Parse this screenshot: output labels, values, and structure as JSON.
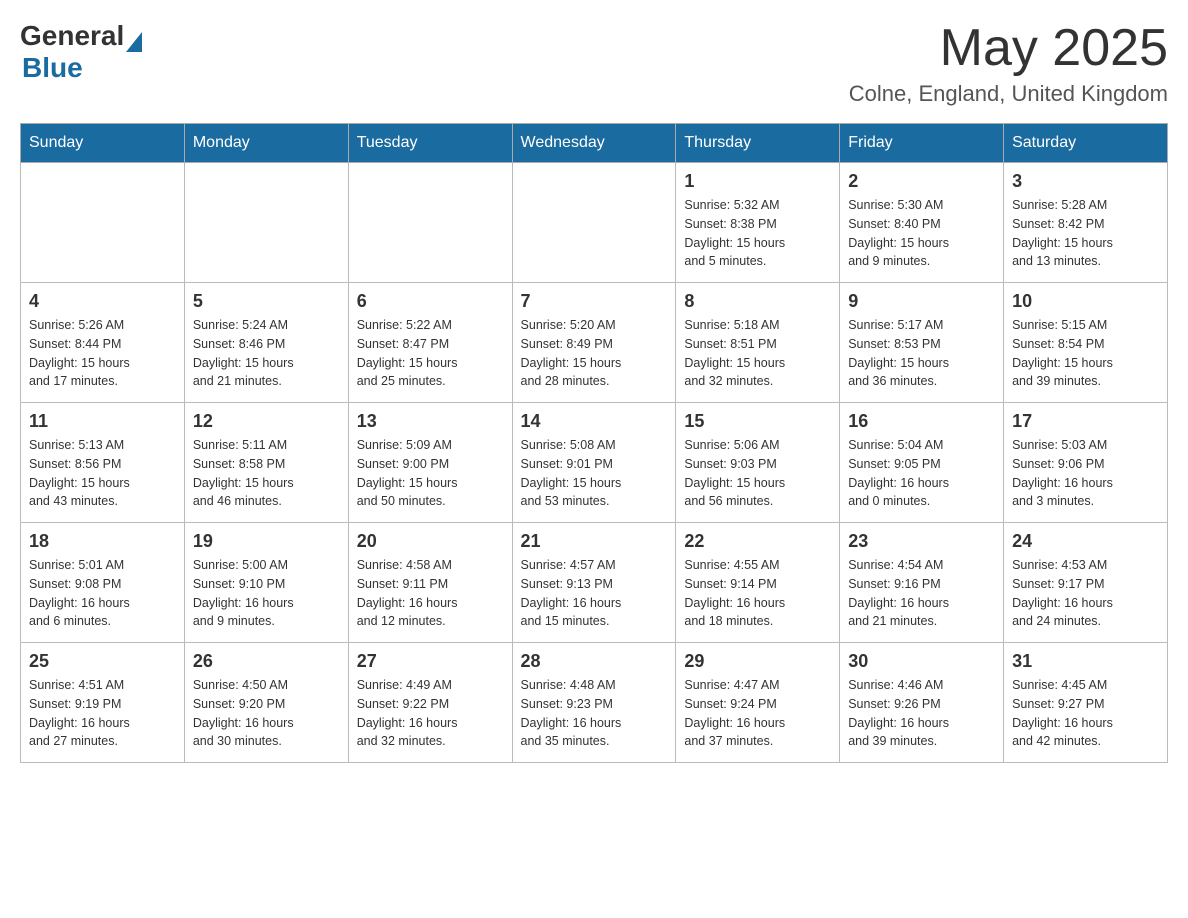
{
  "header": {
    "logo_general": "General",
    "logo_blue": "Blue",
    "month_year": "May 2025",
    "location": "Colne, England, United Kingdom"
  },
  "days_of_week": [
    "Sunday",
    "Monday",
    "Tuesday",
    "Wednesday",
    "Thursday",
    "Friday",
    "Saturday"
  ],
  "weeks": [
    [
      {
        "day": "",
        "info": ""
      },
      {
        "day": "",
        "info": ""
      },
      {
        "day": "",
        "info": ""
      },
      {
        "day": "",
        "info": ""
      },
      {
        "day": "1",
        "info": "Sunrise: 5:32 AM\nSunset: 8:38 PM\nDaylight: 15 hours\nand 5 minutes."
      },
      {
        "day": "2",
        "info": "Sunrise: 5:30 AM\nSunset: 8:40 PM\nDaylight: 15 hours\nand 9 minutes."
      },
      {
        "day": "3",
        "info": "Sunrise: 5:28 AM\nSunset: 8:42 PM\nDaylight: 15 hours\nand 13 minutes."
      }
    ],
    [
      {
        "day": "4",
        "info": "Sunrise: 5:26 AM\nSunset: 8:44 PM\nDaylight: 15 hours\nand 17 minutes."
      },
      {
        "day": "5",
        "info": "Sunrise: 5:24 AM\nSunset: 8:46 PM\nDaylight: 15 hours\nand 21 minutes."
      },
      {
        "day": "6",
        "info": "Sunrise: 5:22 AM\nSunset: 8:47 PM\nDaylight: 15 hours\nand 25 minutes."
      },
      {
        "day": "7",
        "info": "Sunrise: 5:20 AM\nSunset: 8:49 PM\nDaylight: 15 hours\nand 28 minutes."
      },
      {
        "day": "8",
        "info": "Sunrise: 5:18 AM\nSunset: 8:51 PM\nDaylight: 15 hours\nand 32 minutes."
      },
      {
        "day": "9",
        "info": "Sunrise: 5:17 AM\nSunset: 8:53 PM\nDaylight: 15 hours\nand 36 minutes."
      },
      {
        "day": "10",
        "info": "Sunrise: 5:15 AM\nSunset: 8:54 PM\nDaylight: 15 hours\nand 39 minutes."
      }
    ],
    [
      {
        "day": "11",
        "info": "Sunrise: 5:13 AM\nSunset: 8:56 PM\nDaylight: 15 hours\nand 43 minutes."
      },
      {
        "day": "12",
        "info": "Sunrise: 5:11 AM\nSunset: 8:58 PM\nDaylight: 15 hours\nand 46 minutes."
      },
      {
        "day": "13",
        "info": "Sunrise: 5:09 AM\nSunset: 9:00 PM\nDaylight: 15 hours\nand 50 minutes."
      },
      {
        "day": "14",
        "info": "Sunrise: 5:08 AM\nSunset: 9:01 PM\nDaylight: 15 hours\nand 53 minutes."
      },
      {
        "day": "15",
        "info": "Sunrise: 5:06 AM\nSunset: 9:03 PM\nDaylight: 15 hours\nand 56 minutes."
      },
      {
        "day": "16",
        "info": "Sunrise: 5:04 AM\nSunset: 9:05 PM\nDaylight: 16 hours\nand 0 minutes."
      },
      {
        "day": "17",
        "info": "Sunrise: 5:03 AM\nSunset: 9:06 PM\nDaylight: 16 hours\nand 3 minutes."
      }
    ],
    [
      {
        "day": "18",
        "info": "Sunrise: 5:01 AM\nSunset: 9:08 PM\nDaylight: 16 hours\nand 6 minutes."
      },
      {
        "day": "19",
        "info": "Sunrise: 5:00 AM\nSunset: 9:10 PM\nDaylight: 16 hours\nand 9 minutes."
      },
      {
        "day": "20",
        "info": "Sunrise: 4:58 AM\nSunset: 9:11 PM\nDaylight: 16 hours\nand 12 minutes."
      },
      {
        "day": "21",
        "info": "Sunrise: 4:57 AM\nSunset: 9:13 PM\nDaylight: 16 hours\nand 15 minutes."
      },
      {
        "day": "22",
        "info": "Sunrise: 4:55 AM\nSunset: 9:14 PM\nDaylight: 16 hours\nand 18 minutes."
      },
      {
        "day": "23",
        "info": "Sunrise: 4:54 AM\nSunset: 9:16 PM\nDaylight: 16 hours\nand 21 minutes."
      },
      {
        "day": "24",
        "info": "Sunrise: 4:53 AM\nSunset: 9:17 PM\nDaylight: 16 hours\nand 24 minutes."
      }
    ],
    [
      {
        "day": "25",
        "info": "Sunrise: 4:51 AM\nSunset: 9:19 PM\nDaylight: 16 hours\nand 27 minutes."
      },
      {
        "day": "26",
        "info": "Sunrise: 4:50 AM\nSunset: 9:20 PM\nDaylight: 16 hours\nand 30 minutes."
      },
      {
        "day": "27",
        "info": "Sunrise: 4:49 AM\nSunset: 9:22 PM\nDaylight: 16 hours\nand 32 minutes."
      },
      {
        "day": "28",
        "info": "Sunrise: 4:48 AM\nSunset: 9:23 PM\nDaylight: 16 hours\nand 35 minutes."
      },
      {
        "day": "29",
        "info": "Sunrise: 4:47 AM\nSunset: 9:24 PM\nDaylight: 16 hours\nand 37 minutes."
      },
      {
        "day": "30",
        "info": "Sunrise: 4:46 AM\nSunset: 9:26 PM\nDaylight: 16 hours\nand 39 minutes."
      },
      {
        "day": "31",
        "info": "Sunrise: 4:45 AM\nSunset: 9:27 PM\nDaylight: 16 hours\nand 42 minutes."
      }
    ]
  ]
}
